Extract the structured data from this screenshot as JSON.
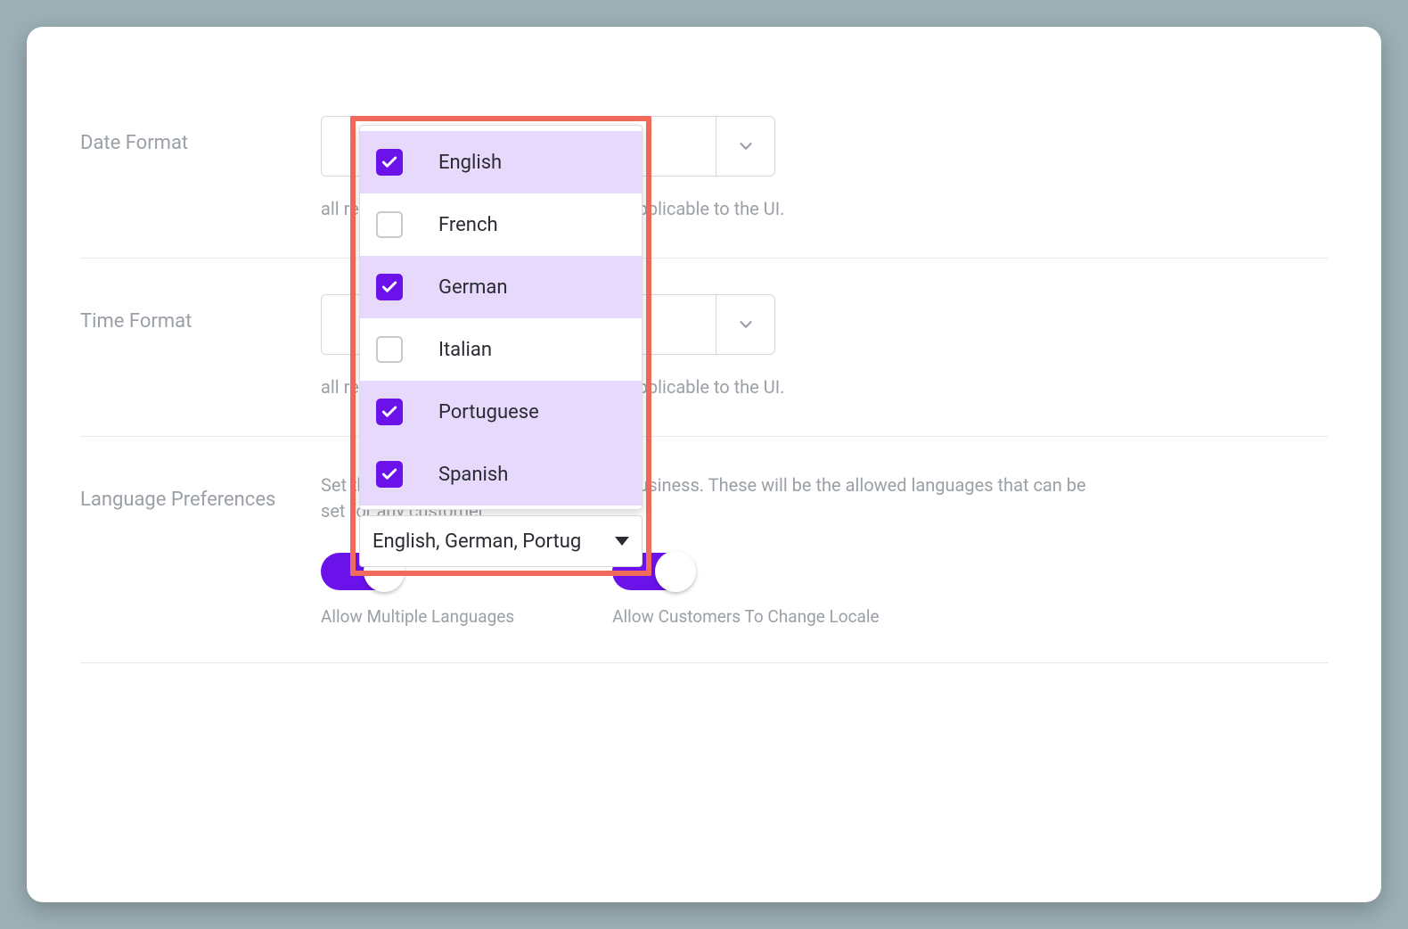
{
  "rows": {
    "date_format": {
      "label": "Date Format",
      "helper": "all reports & views download, It is NOT applicable to the UI."
    },
    "time_format": {
      "label": "Time Format",
      "helper": "all reports & views download, It is NOT applicable to the UI."
    },
    "language_preferences": {
      "label": "Language Preferences",
      "helper": "Set the Language Preferences for your business. These will be the allowed languages that can be set for any customer."
    }
  },
  "toggles": {
    "allow_multiple": {
      "label": "Allow Multiple Languages",
      "on": true
    },
    "allow_customers": {
      "label": "Allow Customers To Change Locale",
      "on": true
    }
  },
  "language_dropdown": {
    "options": [
      {
        "label": "English",
        "selected": true
      },
      {
        "label": "French",
        "selected": false
      },
      {
        "label": "German",
        "selected": true
      },
      {
        "label": "Italian",
        "selected": false
      },
      {
        "label": "Portuguese",
        "selected": true
      },
      {
        "label": "Spanish",
        "selected": true
      }
    ],
    "summary": "English, German, Portug"
  }
}
